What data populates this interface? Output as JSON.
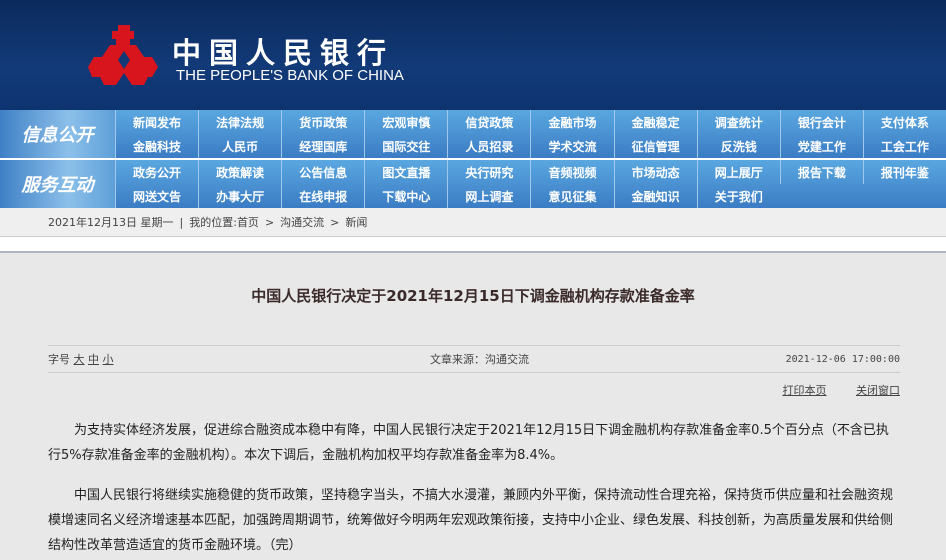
{
  "header": {
    "logo_cn": "中国人民银行",
    "logo_en": "THE PEOPLE'S BANK OF CHINA",
    "brand_color": "#d8141c"
  },
  "nav": {
    "groups": [
      {
        "label": "信息公开",
        "items": [
          "新闻发布",
          "法律法规",
          "货币政策",
          "宏观审慎",
          "信贷政策",
          "金融市场",
          "金融稳定",
          "调查统计",
          "银行会计",
          "支付体系",
          "金融科技",
          "人民币",
          "经理国库",
          "国际交往",
          "人员招录",
          "学术交流",
          "征信管理",
          "反洗钱",
          "党建工作",
          "工会工作"
        ]
      },
      {
        "label": "服务互动",
        "items": [
          "政务公开",
          "政策解读",
          "公告信息",
          "图文直播",
          "央行研究",
          "音频视频",
          "市场动态",
          "网上展厅",
          "报告下载",
          "报刊年鉴",
          "网送文告",
          "办事大厅",
          "在线申报",
          "下载中心",
          "网上调查",
          "意见征集",
          "金融知识",
          "关于我们"
        ]
      }
    ]
  },
  "breadcrumb": {
    "date": "2021年12月13日 星期一",
    "sep": "|",
    "location_label": "我的位置:",
    "home": "首页",
    "arrow": ">",
    "level1": "沟通交流",
    "level2": "新闻"
  },
  "article": {
    "title": "中国人民银行决定于2021年12月15日下调金融机构存款准备金率",
    "font_label": "字号",
    "font_large": "大",
    "font_medium": "中",
    "font_small": "小",
    "source": "文章来源：沟通交流",
    "datetime": "2021-12-06 17:00:00",
    "print": "打印本页",
    "close": "关闭窗口",
    "paragraphs": [
      "为支持实体经济发展，促进综合融资成本稳中有降，中国人民银行决定于2021年12月15日下调金融机构存款准备金率0.5个百分点（不含已执行5%存款准备金率的金融机构）。本次下调后，金融机构加权平均存款准备金率为8.4%。",
      "中国人民银行将继续实施稳健的货币政策，坚持稳字当头，不搞大水漫灌，兼顾内外平衡，保持流动性合理充裕，保持货币供应量和社会融资规模增速同名义经济增速基本匹配，加强跨周期调节，统筹做好今明两年宏观政策衔接，支持中小企业、绿色发展、科技创新，为高质量发展和供给侧结构性改革营造适宜的货币金融环境。（完）"
    ]
  }
}
